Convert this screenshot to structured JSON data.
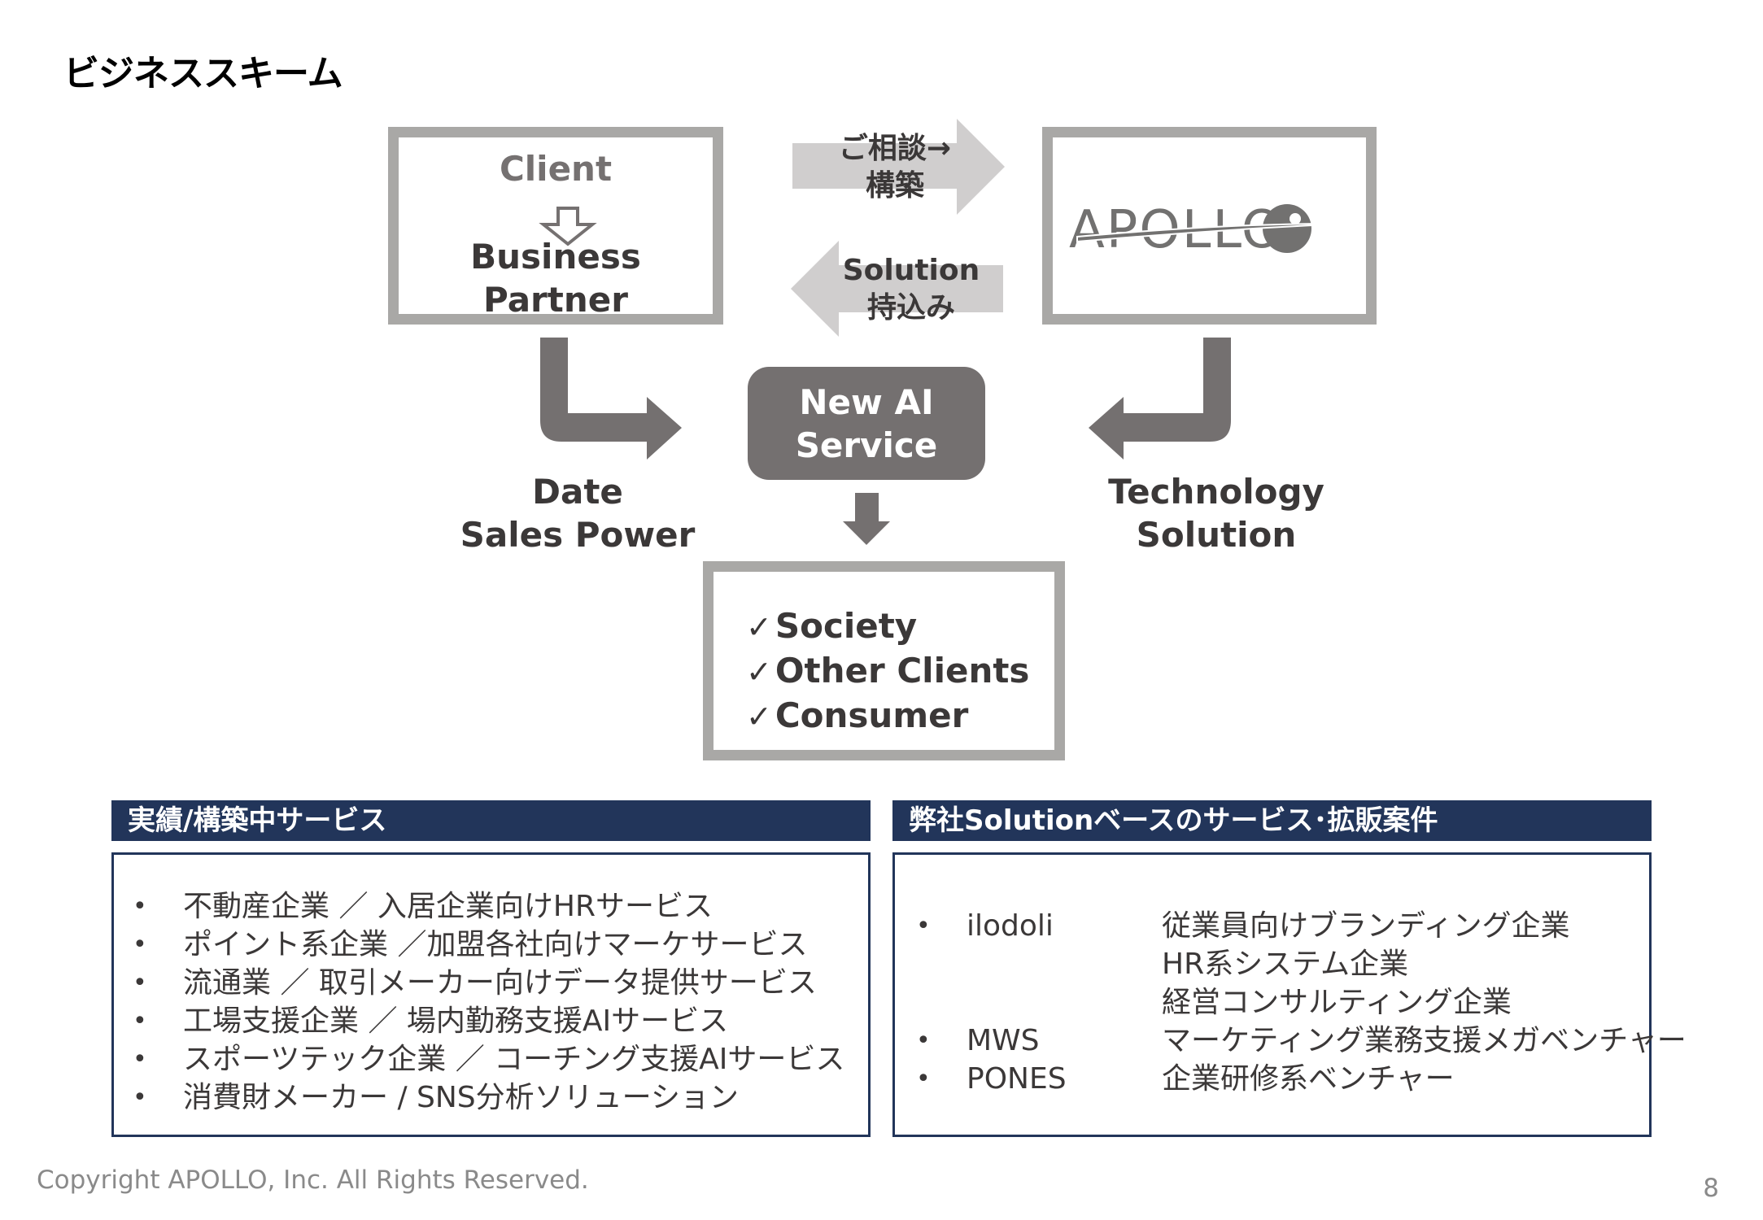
{
  "page": {
    "title": "ビジネススキーム",
    "footer": "Copyright APOLLO, Inc. All Rights Reserved.",
    "page_number": "8"
  },
  "diagram": {
    "client_box": {
      "top_label": "Client",
      "bottom_label": "Business\nPartner"
    },
    "apollo_box": {
      "logo_text": "APOLLO"
    },
    "arrow_to_apollo_label": "ご相談→\n構築",
    "arrow_to_client_label": "Solution\n持込み",
    "center_box_label": "New AI\nService",
    "left_label": "Date\nSales Power",
    "right_label": "Technology\nSolution",
    "result_items": [
      "Society",
      "Other Clients",
      "Consumer"
    ],
    "check_glyph": "✓"
  },
  "colors": {
    "dark_gray": "#747070",
    "box_border": "#a9a8a6",
    "light_arrow": "#d0cece",
    "navy": "#22355a"
  },
  "panels": {
    "left": {
      "header": "実績/構築中サービス",
      "items": [
        "不動産企業 ／ 入居企業向けHRサービス",
        "ポイント系企業 ／加盟各社向けマーケサービス",
        "流通業 ／ 取引メーカー向けデータ提供サービス",
        "工場支援企業 ／ 場内勤務支援AIサービス",
        "スポーツテック企業 ／ コーチング支援AIサービス",
        "消費財メーカー / SNS分析ソリューション"
      ]
    },
    "right": {
      "header": "弊社Solutionベースのサービス･拡販案件",
      "items": [
        {
          "name": "ilodoli",
          "descriptions": [
            "従業員向けブランディング企業",
            "HR系システム企業",
            "経営コンサルティング企業"
          ]
        },
        {
          "name": "MWS",
          "descriptions": [
            "マーケティング業務支援メガベンチャー"
          ]
        },
        {
          "name": "PONES",
          "descriptions": [
            "企業研修系ベンチャー"
          ]
        }
      ]
    },
    "bullet_glyph": "•"
  }
}
